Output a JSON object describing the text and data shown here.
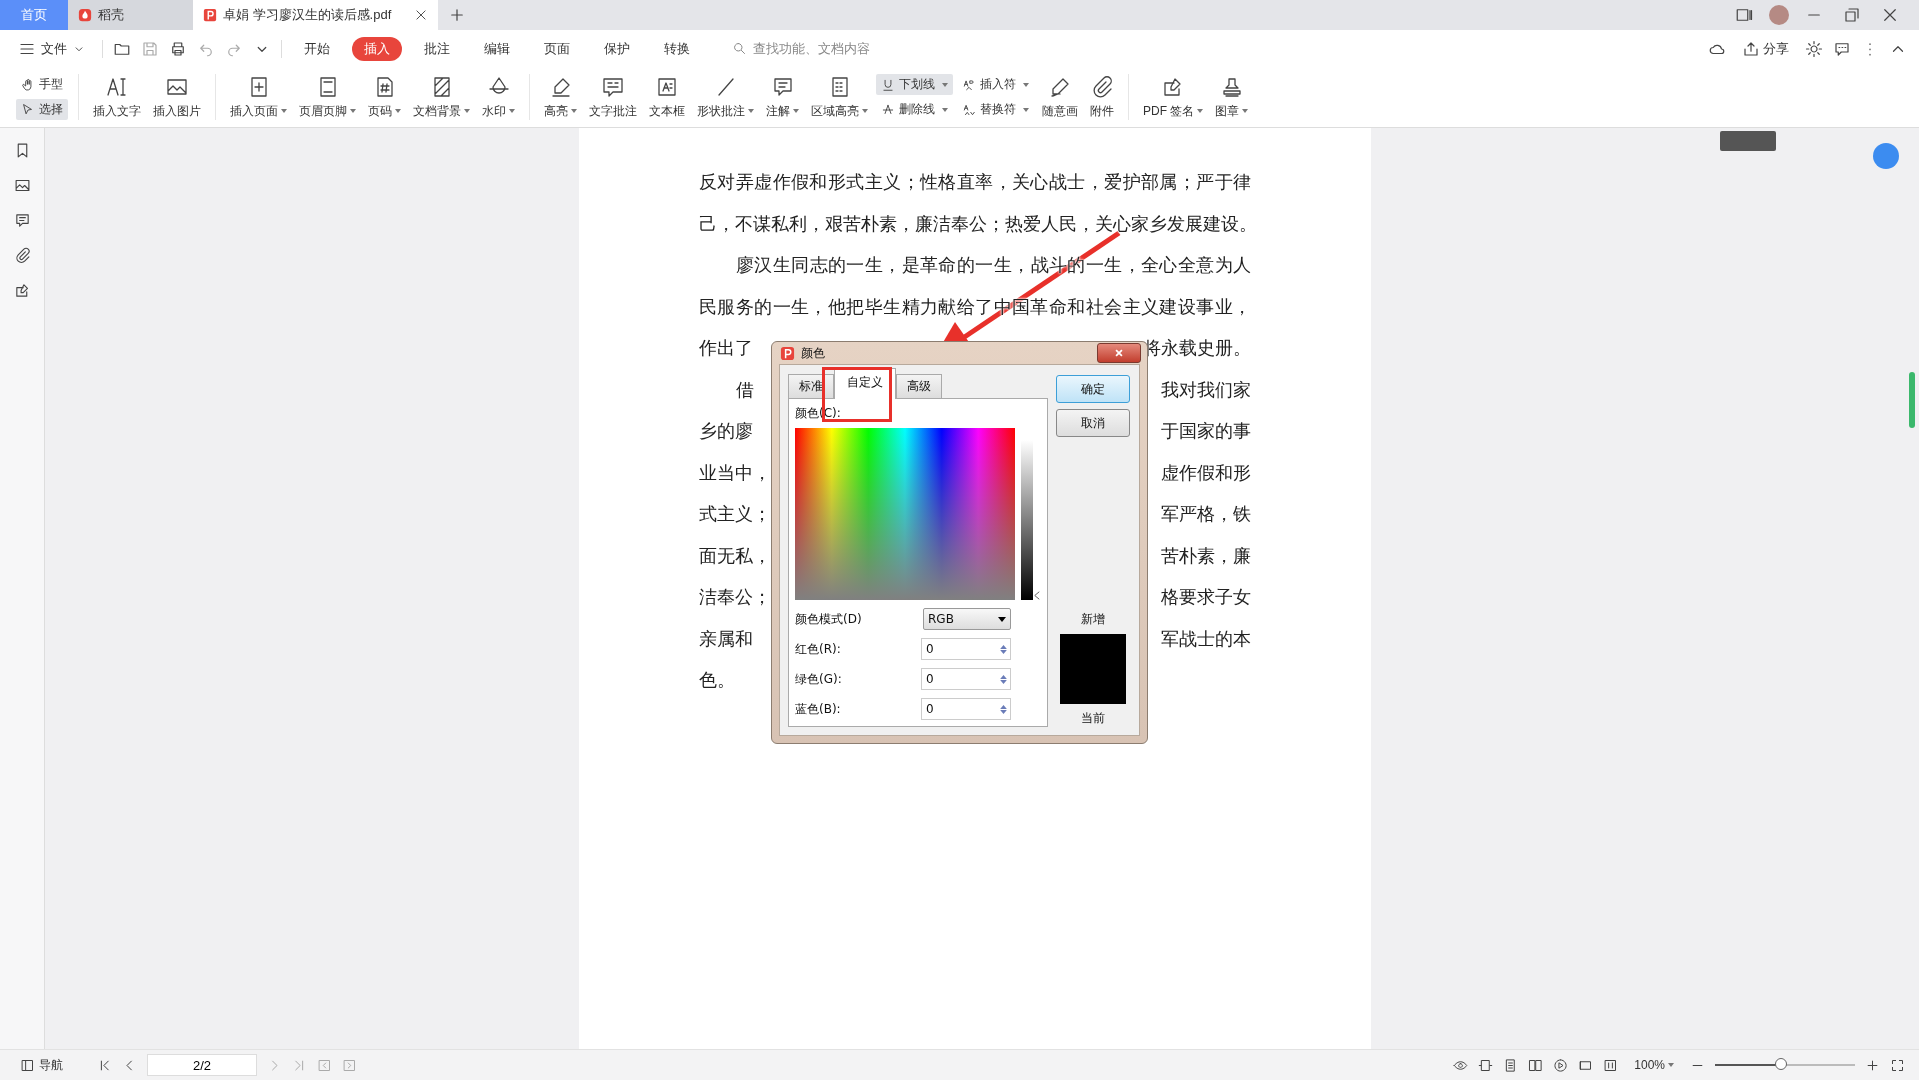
{
  "tabs": [
    {
      "label": "首页",
      "kind": "home",
      "selected": false
    },
    {
      "label": "稻壳",
      "kind": "app",
      "selected": false
    },
    {
      "label": "卓娟 学习廖汉生的读后感.pdf",
      "kind": "doc",
      "selected": true
    }
  ],
  "menu": {
    "file": "文件",
    "items": [
      {
        "label": "开始",
        "selected": false
      },
      {
        "label": "插入",
        "selected": true
      },
      {
        "label": "批注",
        "selected": false
      },
      {
        "label": "编辑",
        "selected": false
      },
      {
        "label": "页面",
        "selected": false
      },
      {
        "label": "保护",
        "selected": false
      },
      {
        "label": "转换",
        "selected": false
      }
    ],
    "search_placeholder": "查找功能、文档内容",
    "share": "分享"
  },
  "modes": [
    {
      "label": "手型",
      "selected": false
    },
    {
      "label": "选择",
      "selected": true
    }
  ],
  "tool_groups": [
    [
      {
        "kind": "big",
        "label": "插入文字",
        "dropdown": false
      },
      {
        "kind": "big",
        "label": "插入图片",
        "dropdown": false
      }
    ],
    [
      {
        "kind": "big",
        "label": "插入页面",
        "dropdown": true
      },
      {
        "kind": "big",
        "label": "页眉页脚",
        "dropdown": true
      },
      {
        "kind": "big",
        "label": "页码",
        "dropdown": true
      },
      {
        "kind": "big",
        "label": "文档背景",
        "dropdown": true
      },
      {
        "kind": "big",
        "label": "水印",
        "dropdown": true
      }
    ],
    [
      {
        "kind": "big",
        "label": "高亮",
        "dropdown": true
      },
      {
        "kind": "big",
        "label": "文字批注",
        "dropdown": false
      },
      {
        "kind": "big",
        "label": "文本框",
        "dropdown": false
      },
      {
        "kind": "big",
        "label": "形状批注",
        "dropdown": true
      },
      {
        "kind": "big",
        "label": "注解",
        "dropdown": true
      },
      {
        "kind": "big",
        "label": "区域高亮",
        "dropdown": true
      },
      {
        "kind": "pair",
        "items": [
          {
            "label": "下划线",
            "dropdown": true,
            "selected": true
          },
          {
            "label": "删除线",
            "dropdown": true,
            "selected": false
          }
        ]
      },
      {
        "kind": "pair",
        "items": [
          {
            "label": "插入符",
            "dropdown": true,
            "selected": false
          },
          {
            "label": "替换符",
            "dropdown": true,
            "selected": false
          }
        ]
      },
      {
        "kind": "big",
        "label": "随意画",
        "dropdown": false
      },
      {
        "kind": "big",
        "label": "附件",
        "dropdown": false
      }
    ],
    [
      {
        "kind": "big",
        "label": "PDF 签名",
        "dropdown": true
      },
      {
        "kind": "big",
        "label": "图章",
        "dropdown": true
      }
    ]
  ],
  "document": {
    "lines": [
      {
        "indent": false,
        "left": "反对弄虚作假和形式主义；性格直率，关心战士，爱护部属；严于律"
      },
      {
        "indent": false,
        "left": "己，不谋私利，艰苦朴素，廉洁奉公；热爱人民，关心家乡发展建设。"
      },
      {
        "indent": true,
        "left": "廖汉生同志的一生，是革命的一生，战斗的一生，全心全意为人"
      },
      {
        "indent": false,
        "left": "民服务的一生，他把毕生精力献给了中国革命和社会主义建设事业，"
      },
      {
        "indent": false,
        "left": "作出了",
        "right": "将永载史册。"
      },
      {
        "indent": true,
        "left": "借",
        "right": "我对我们家"
      },
      {
        "indent": false,
        "left": "乡的廖",
        "right": "于国家的事"
      },
      {
        "indent": false,
        "left": "业当中，",
        "right": "虚作假和形"
      },
      {
        "indent": false,
        "left": "式主义；",
        "right": "军严格，铁"
      },
      {
        "indent": false,
        "left": "面无私，",
        "right": "苦朴素，廉"
      },
      {
        "indent": false,
        "left": "洁奉公；",
        "right": "格要求子女"
      },
      {
        "indent": false,
        "left": "亲属和",
        "right": "军战士的本"
      },
      {
        "indent": false,
        "left": "色。"
      }
    ]
  },
  "dialog": {
    "title": "颜色",
    "tabs": [
      {
        "label": "标准",
        "selected": false
      },
      {
        "label": "自定义",
        "selected": true
      },
      {
        "label": "高级",
        "selected": false
      }
    ],
    "color_label": "颜色(C):",
    "mode_label": "颜色模式(D)",
    "mode_value": "RGB",
    "channels": [
      {
        "label": "红色(R):",
        "value": "0"
      },
      {
        "label": "绿色(G):",
        "value": "0"
      },
      {
        "label": "蓝色(B):",
        "value": "0"
      }
    ],
    "ok": "确定",
    "cancel": "取消",
    "new_label": "新增",
    "current_label": "当前"
  },
  "status_bar": {
    "nav": "导航",
    "page": "2/2",
    "zoom": "100%",
    "zoom_slider": {
      "level": 0.47
    }
  }
}
